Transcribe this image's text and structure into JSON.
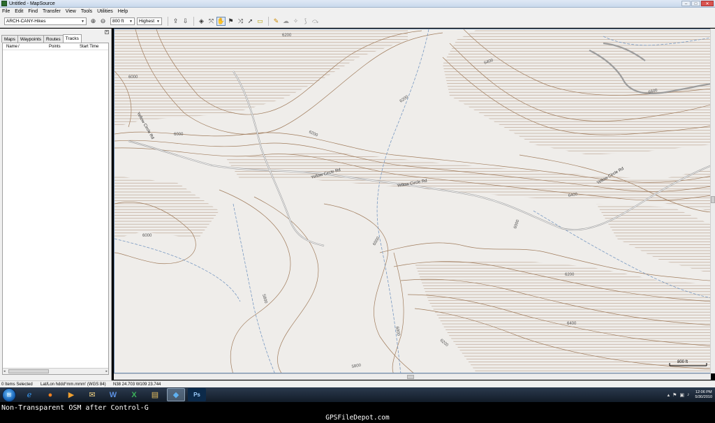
{
  "window": {
    "title": "Untitled - MapSource",
    "controls": [
      "–",
      "□",
      "✕"
    ]
  },
  "menu": [
    "File",
    "Edit",
    "Find",
    "Transfer",
    "View",
    "Tools",
    "Utilities",
    "Help"
  ],
  "toolbar": {
    "product": "ARCH-CANY-Hikes",
    "zoom": "800 ft",
    "detail": "Highest",
    "tools": [
      {
        "name": "zoom-in-icon",
        "glyph": "⊕"
      },
      {
        "name": "zoom-out-icon",
        "glyph": "⊖"
      },
      {
        "name": "send-to-device-icon",
        "glyph": "⇪"
      },
      {
        "name": "receive-from-device-icon",
        "glyph": "⇩"
      },
      {
        "name": "map-tool-icon",
        "glyph": "◈"
      },
      {
        "name": "selection-tool-icon",
        "glyph": "⤧"
      },
      {
        "name": "hand-tool-icon",
        "glyph": "✋"
      },
      {
        "name": "waypoint-tool-icon",
        "glyph": "⚑"
      },
      {
        "name": "route-tool-icon",
        "glyph": "⤨"
      },
      {
        "name": "select-arrow-icon",
        "glyph": "➚"
      },
      {
        "name": "distance-tool-icon",
        "glyph": "▭"
      },
      {
        "name": "find-icon",
        "glyph": "✎"
      },
      {
        "name": "track-tool-icon",
        "glyph": "☁"
      },
      {
        "name": "erase-tool-icon",
        "glyph": "✧"
      },
      {
        "name": "split-tool-icon",
        "glyph": "⟆"
      },
      {
        "name": "join-tool-icon",
        "glyph": "⤼"
      }
    ]
  },
  "leftpanel": {
    "tabs": [
      "Maps",
      "Waypoints",
      "Routes",
      "Tracks"
    ],
    "active_tab": "Tracks",
    "columns": [
      "Name",
      "/",
      "Points",
      "Start Time"
    ]
  },
  "map": {
    "scale": "800 ft",
    "contour_labels": [
      "6200",
      "6400",
      "6600",
      "6000",
      "6200",
      "6200",
      "6400",
      "6000",
      "6000",
      "5800",
      "6000",
      "6200",
      "6400",
      "6200",
      "5800",
      "6000",
      "6000"
    ],
    "road_labels": [
      "Yellow Circle Rd",
      "Yellow Circle Rd",
      "Yellow Circle Rd",
      "Yellow Circle Rd"
    ]
  },
  "status": {
    "selected": "0 Items Selected",
    "format": "Lat/Lon hddd°mm.mmm' (WGS 84)",
    "coords": "N38 24.703 W109 23.744"
  },
  "taskbar": {
    "apps": [
      {
        "name": "ie-icon",
        "glyph": "ℯ"
      },
      {
        "name": "firefox-icon",
        "glyph": "●"
      },
      {
        "name": "media-player-icon",
        "glyph": "▶"
      },
      {
        "name": "mail-icon",
        "glyph": "✉"
      },
      {
        "name": "word-icon",
        "glyph": "W"
      },
      {
        "name": "excel-icon",
        "glyph": "X"
      },
      {
        "name": "explorer-icon",
        "glyph": "▤"
      },
      {
        "name": "mapsource-icon",
        "glyph": "◆"
      },
      {
        "name": "photoshop-icon",
        "glyph": "Ps"
      }
    ],
    "time": "12:06 PM",
    "date": "5/30/2010"
  },
  "caption": {
    "line1": "Non-Transparent OSM after Control-G",
    "line2": "GPSFileDepot.com"
  },
  "colors": {
    "contour": "#a07c5c",
    "hatch": "#b59a85",
    "stream": "#7899c2",
    "road": "#9c9c9c",
    "map_bg": "#efedea"
  }
}
